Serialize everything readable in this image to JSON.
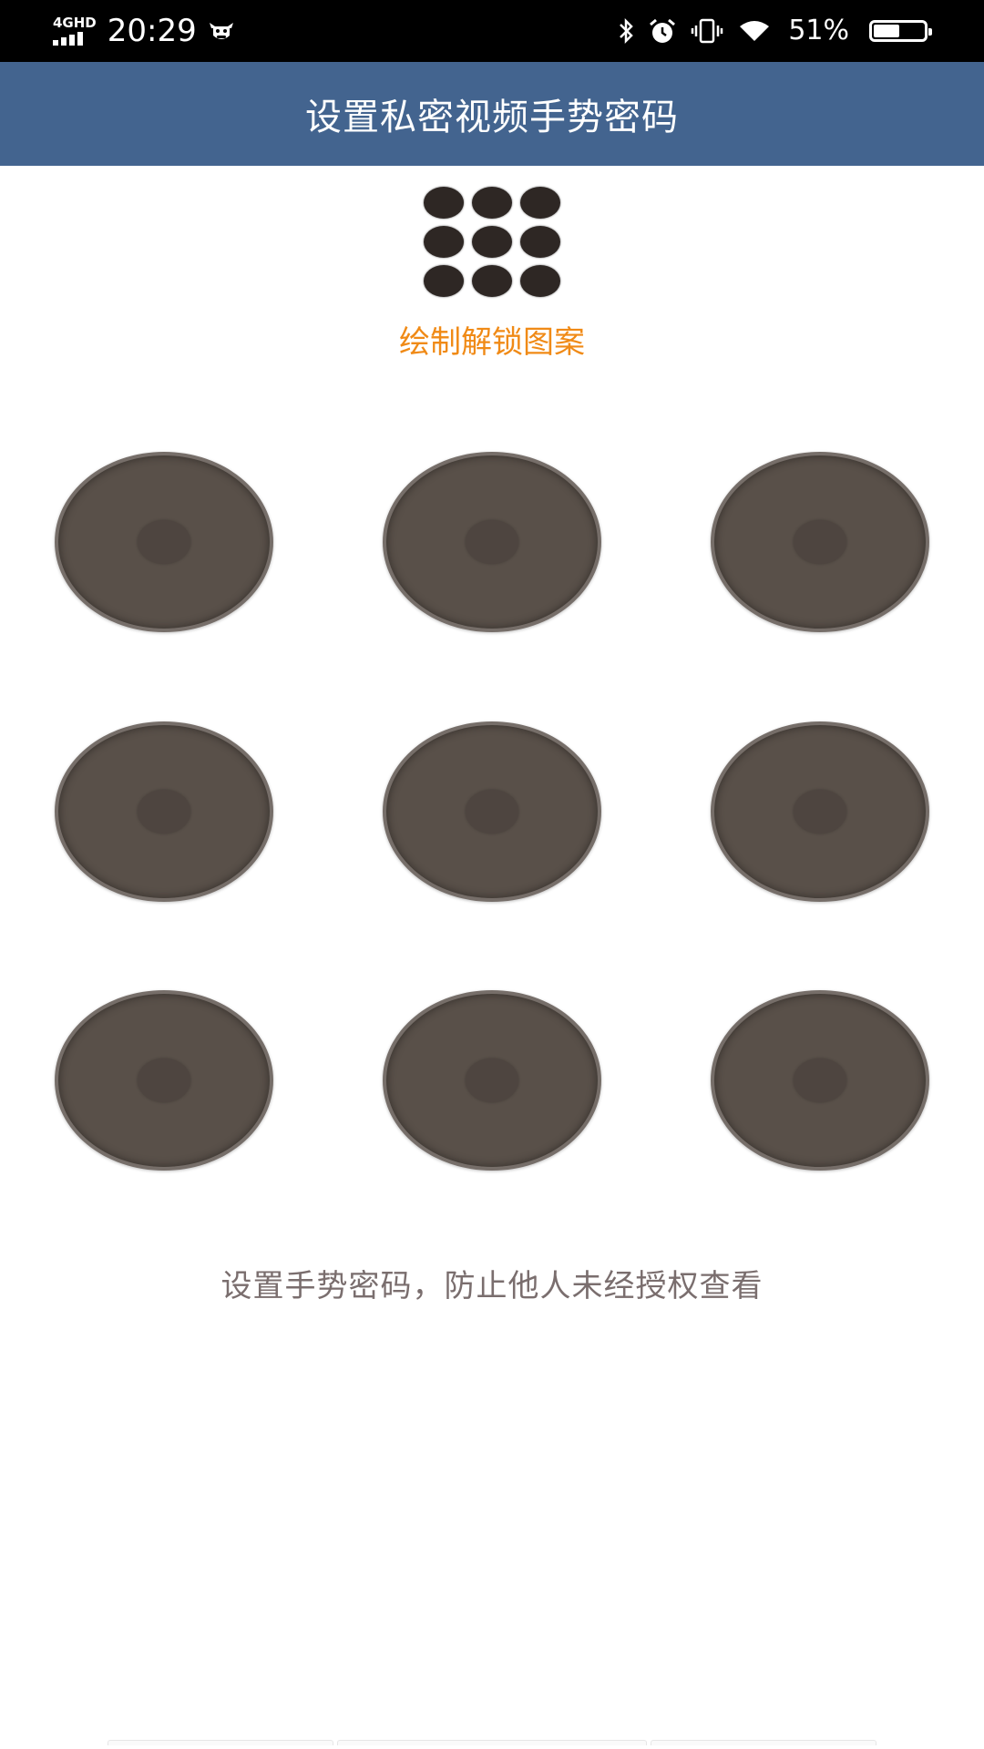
{
  "status_bar": {
    "network": "4GHD",
    "time": "20:29",
    "battery_percent": "51%",
    "battery_level": 0.51,
    "icons": [
      "bluetooth-icon",
      "alarm-icon",
      "vibrate-icon",
      "wifi-icon"
    ]
  },
  "title_bar": {
    "title": "设置私密视频手势密码",
    "background": "#43648f"
  },
  "preview": {
    "rows": 3,
    "cols": 3,
    "prompt": "绘制解锁图案",
    "prompt_color": "#f08a16"
  },
  "lock_pattern": {
    "rows": 3,
    "cols": 3,
    "selected_nodes": []
  },
  "hint": "设置手势密码，防止他人未经授权查看",
  "colors": {
    "node_fill": "#595049",
    "node_border": "#766e69",
    "hint_text": "#7a6e6e"
  }
}
